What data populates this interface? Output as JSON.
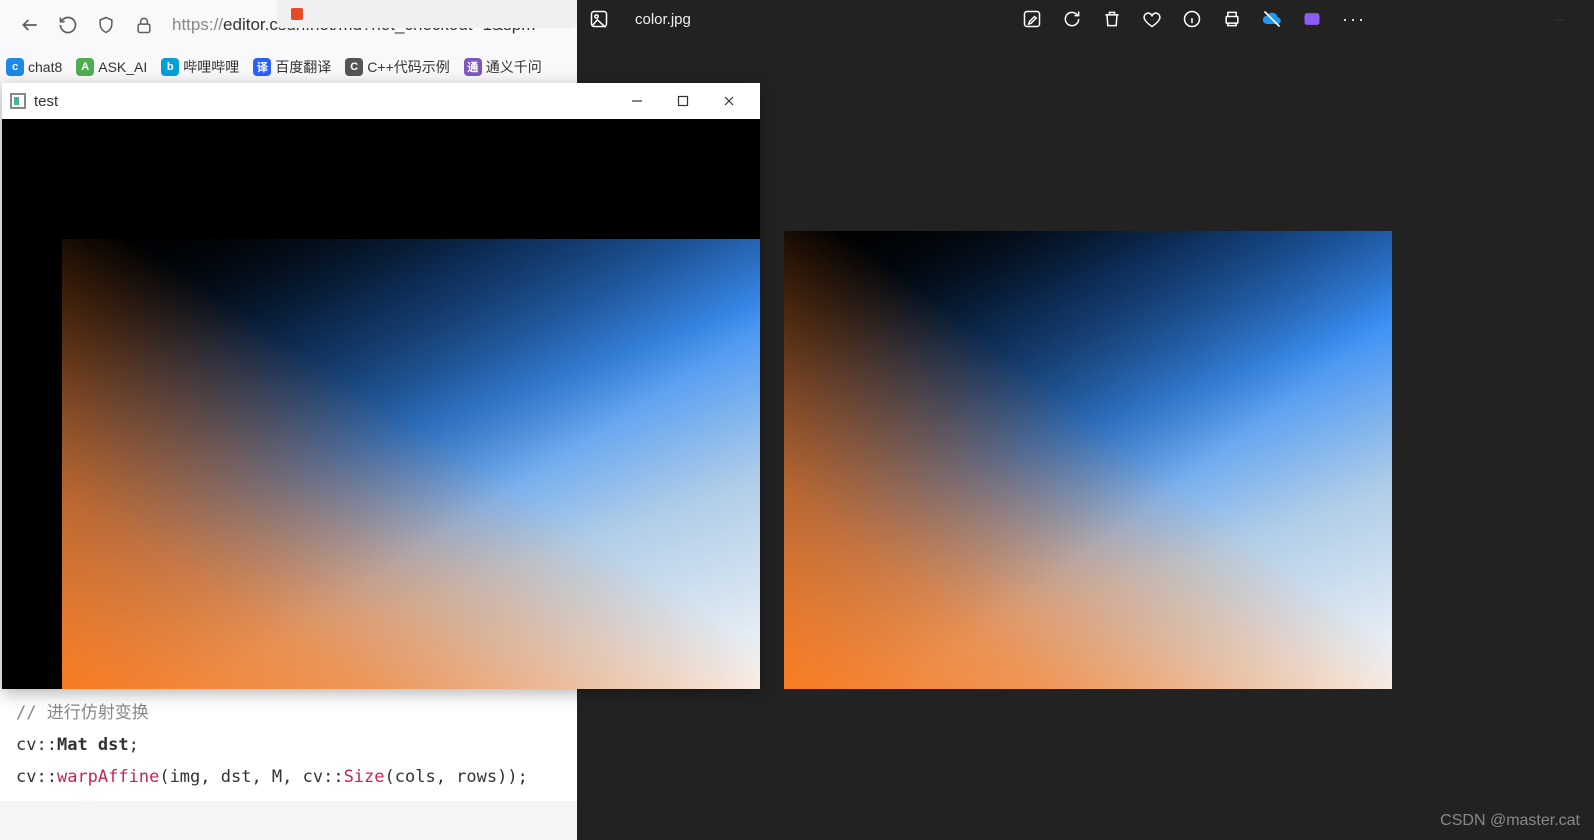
{
  "browser": {
    "url_prefix": "https://",
    "url_rest": "editor.csdn.net/md?not_checkout=1&spm=",
    "bookmarks": [
      {
        "label": "chat8",
        "color": "#1e88e5"
      },
      {
        "label": "ASK_AI",
        "color": "#4caf50"
      },
      {
        "label": "哔哩哔哩",
        "color": "#00a1d6"
      },
      {
        "label": "百度翻译",
        "color": "#2962ff"
      },
      {
        "label": "C++代码示例",
        "color": "#555"
      },
      {
        "label": "通义千问",
        "color": "#7e57c2"
      }
    ]
  },
  "test_window": {
    "title": "test"
  },
  "viewer": {
    "filename": "color.jpg",
    "watermark": "CSDN @master.cat"
  },
  "code": {
    "line1_comment": "// 进行仿射变换",
    "line2_a": "cv",
    "line2_b": "::",
    "line2_c": "Mat dst",
    "line2_d": ";",
    "line3_a": "cv",
    "line3_b": "::",
    "line3_fn": "warpAffine",
    "line3_c": "(img, dst, M, cv::",
    "line3_cls": "Size",
    "line3_d": "(cols, rows));"
  }
}
